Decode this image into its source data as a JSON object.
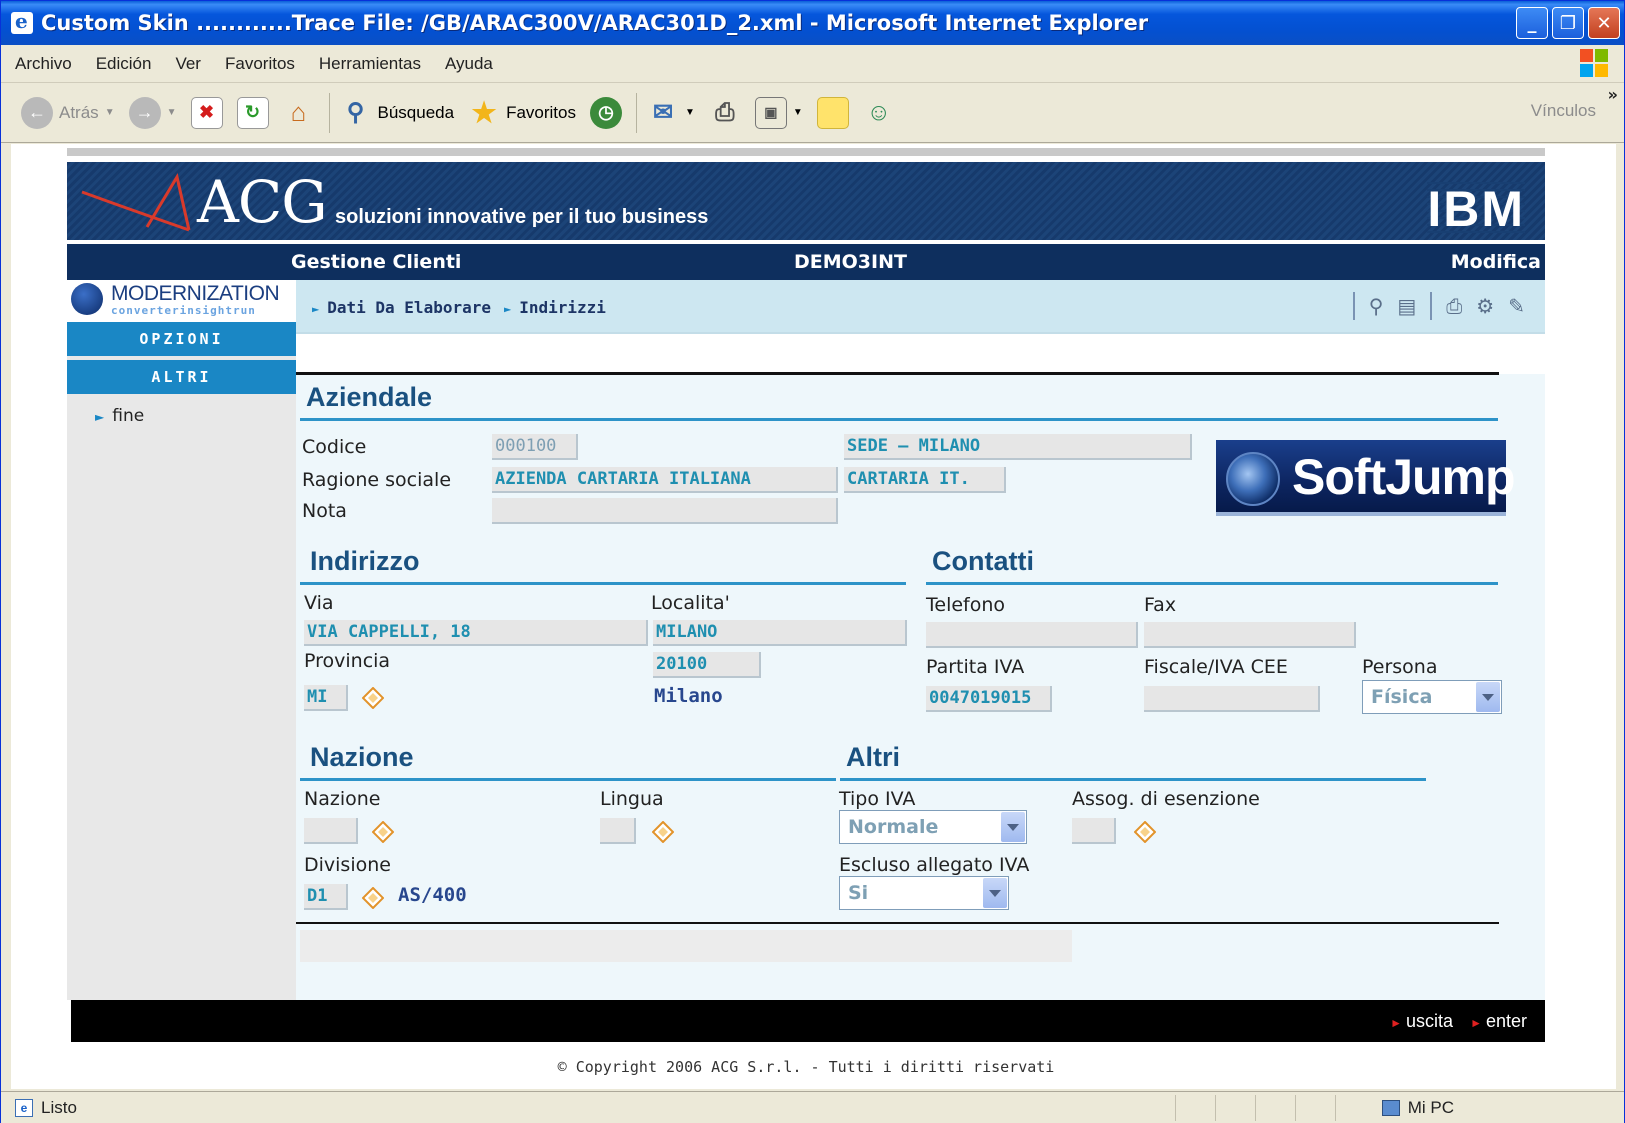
{
  "window": {
    "title": "Custom Skin ............Trace File: /GB/ARAC300V/ARAC301D_2.xml - Microsoft Internet Explorer",
    "minimize": "_",
    "restore": "❐",
    "close": "✕"
  },
  "menu": [
    "Archivo",
    "Edición",
    "Ver",
    "Favoritos",
    "Herramientas",
    "Ayuda"
  ],
  "toolbar": {
    "back": "Atrás",
    "search": "Búsqueda",
    "favorites": "Favoritos",
    "links": "Vínculos"
  },
  "banner": {
    "brand": "ACG",
    "tagline": "soluzioni innovative per il tuo business",
    "partner": "IBM"
  },
  "navbar": {
    "section": "Gestione Clienti",
    "environment": "DEMO3INT",
    "mode": "Modifica"
  },
  "sidebar": {
    "logo_main": "MODERNIZATION",
    "logo_sub": "converterinsightrun",
    "tab_options": "OPZIONI",
    "tab_others": "ALTRI",
    "link_end": "fine"
  },
  "breadcrumb": [
    "Dati Da Elaborare",
    "Indirizzi"
  ],
  "aziendale": {
    "heading": "Aziendale",
    "codice_label": "Codice",
    "codice_value": "000100",
    "sede_value": "SEDE – MILANO",
    "ragione_label": "Ragione sociale",
    "ragione_value": "AZIENDA CARTARIA ITALIANA",
    "ragione_short": "CARTARIA IT.",
    "nota_label": "Nota",
    "nota_value": ""
  },
  "logo_softjump": "SoftJump",
  "indirizzo": {
    "heading": "Indirizzo",
    "via_label": "Via",
    "via_value": "VIA CAPPELLI, 18",
    "localita_label": "Localita'",
    "localita_value": "MILANO",
    "provincia_label": "Provincia",
    "provincia_value": "MI",
    "cap_value": "20100",
    "city_desc": "Milano"
  },
  "contatti": {
    "heading": "Contatti",
    "telefono_label": "Telefono",
    "fax_label": "Fax",
    "piva_label": "Partita IVA",
    "piva_value": "0047019015",
    "fiscale_label": "Fiscale/IVA CEE",
    "persona_label": "Persona",
    "persona_value": "Física"
  },
  "nazione": {
    "heading": "Nazione",
    "nazione_label": "Nazione",
    "lingua_label": "Lingua",
    "divisione_label": "Divisione",
    "divisione_value": "D1",
    "divisione_desc": "AS/400"
  },
  "altri": {
    "heading": "Altri",
    "tipo_iva_label": "Tipo IVA",
    "tipo_iva_value": "Normale",
    "assog_label": "Assog. di esenzione",
    "escluso_label": "Escluso allegato IVA",
    "escluso_value": "Si"
  },
  "footer": {
    "exit": "uscita",
    "enter": "enter",
    "copyright": "© Copyright 2006 ACG S.r.l. - Tutti i diritti riservati"
  },
  "status": {
    "left": "Listo",
    "zone": "Mi PC"
  }
}
